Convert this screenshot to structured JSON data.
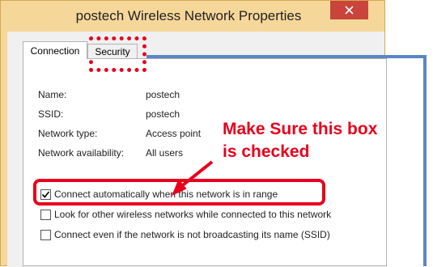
{
  "window": {
    "title": "postech Wireless Network Properties",
    "close_icon": "close-icon",
    "titlebar_color": "#f6d79a",
    "close_color": "#c9443b"
  },
  "tabs": [
    {
      "label": "Connection",
      "active": true
    },
    {
      "label": "Security",
      "active": false
    }
  ],
  "info": [
    {
      "label": "Name:",
      "value": "postech"
    },
    {
      "label": "SSID:",
      "value": "postech"
    },
    {
      "label": "Network type:",
      "value": "Access point"
    },
    {
      "label": "Network availability:",
      "value": "All users"
    }
  ],
  "checkboxes": [
    {
      "label": "Connect automatically when this network is in range",
      "checked": true
    },
    {
      "label": "Look for other wireless networks while connected to this network",
      "checked": false
    },
    {
      "label": "Connect even if the network is not broadcasting its name (SSID)",
      "checked": false
    }
  ],
  "annotation": {
    "text_line1": "Make Sure this box",
    "text_line2": "is checked",
    "color": "#e8001c",
    "connector_color": "#5a86c4"
  }
}
